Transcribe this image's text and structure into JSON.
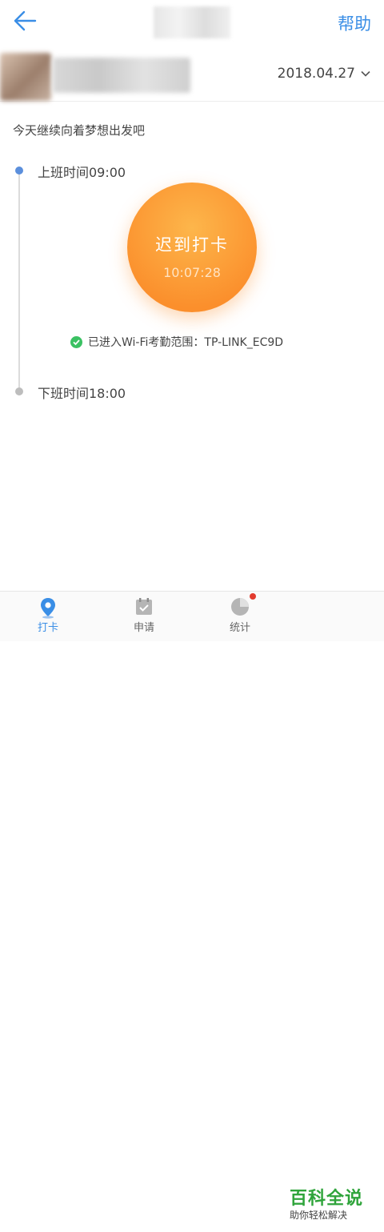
{
  "header": {
    "help_label": "帮助"
  },
  "userbar": {
    "date": "2018.04.27"
  },
  "motto": "今天继续向着梦想出发吧",
  "schedule": {
    "on_work": "上班时间09:00",
    "off_work": "下班时间18:00"
  },
  "punch": {
    "label": "迟到打卡",
    "time": "10:07:28"
  },
  "wifi": {
    "status": "已进入Wi-Fi考勤范围：TP-LINK_EC9D"
  },
  "tabs": [
    {
      "label": "打卡",
      "icon": "location-pin-icon"
    },
    {
      "label": "申请",
      "icon": "calendar-check-icon"
    },
    {
      "label": "统计",
      "icon": "pie-chart-icon"
    }
  ],
  "watermark": {
    "brand": "百科全说",
    "slogan": "助你轻松解决"
  },
  "colors": {
    "accent": "#3a8ee6",
    "punch": "#fb8f2c",
    "success": "#3ac162",
    "badge": "#e23b2e"
  }
}
